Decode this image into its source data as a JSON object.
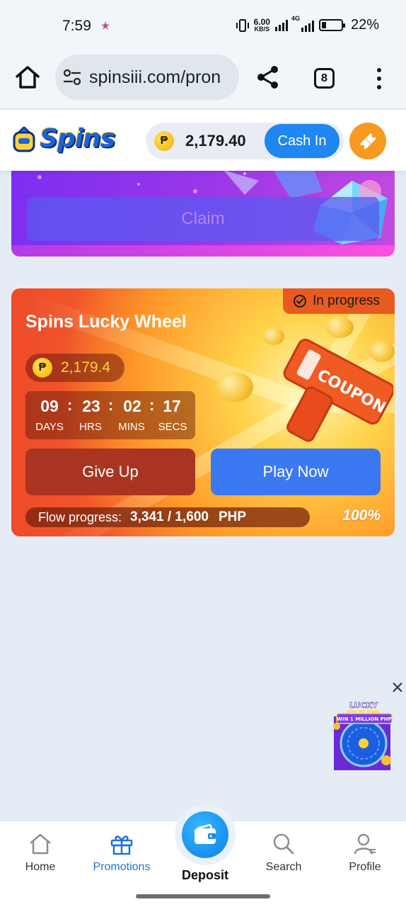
{
  "status_bar": {
    "time": "7:59",
    "net_speed_value": "6.00",
    "net_speed_unit": "KB/S",
    "network_type": "4G",
    "battery": "22%"
  },
  "browser": {
    "url": "spinsiii.com/pron",
    "tab_count": "8"
  },
  "header": {
    "logo_text": "Spins",
    "currency_symbol": "₱",
    "balance": "2,179.40",
    "cash_in_label": "Cash In"
  },
  "promo_top": {
    "claim_label": "Claim"
  },
  "lucky_wheel": {
    "status": "In progress",
    "title": "Spins Lucky Wheel",
    "currency_symbol": "₱",
    "amount": "2,179.4",
    "countdown": {
      "days": "09",
      "hours": "23",
      "mins": "02",
      "secs": "17",
      "separator": ":",
      "days_label": "DAYS",
      "hours_label": "HRS",
      "mins_label": "MINS",
      "secs_label": "SECS"
    },
    "give_up_label": "Give Up",
    "play_now_label": "Play Now",
    "flow_label": "Flow progress:",
    "flow_value": "3,341 / 1,600",
    "flow_unit": "PHP",
    "flow_percent": "100%",
    "coupon_text": "COUPON"
  },
  "ad": {
    "title": "LUCKY",
    "subtitle": "SPIN THE WHEEL",
    "prize": "WIN 1 MILLION PHP"
  },
  "bottom_nav": {
    "home": "Home",
    "promotions": "Promotions",
    "deposit": "Deposit",
    "search": "Search",
    "profile": "Profile",
    "active": "promotions"
  },
  "colors": {
    "accent_blue": "#1f86f2",
    "play_now_blue": "#3a79f2",
    "give_up_red": "#a83421",
    "card_orange": "#f2682b",
    "promo_purple": "#9c38e8",
    "coin_gold": "#f2b100"
  }
}
